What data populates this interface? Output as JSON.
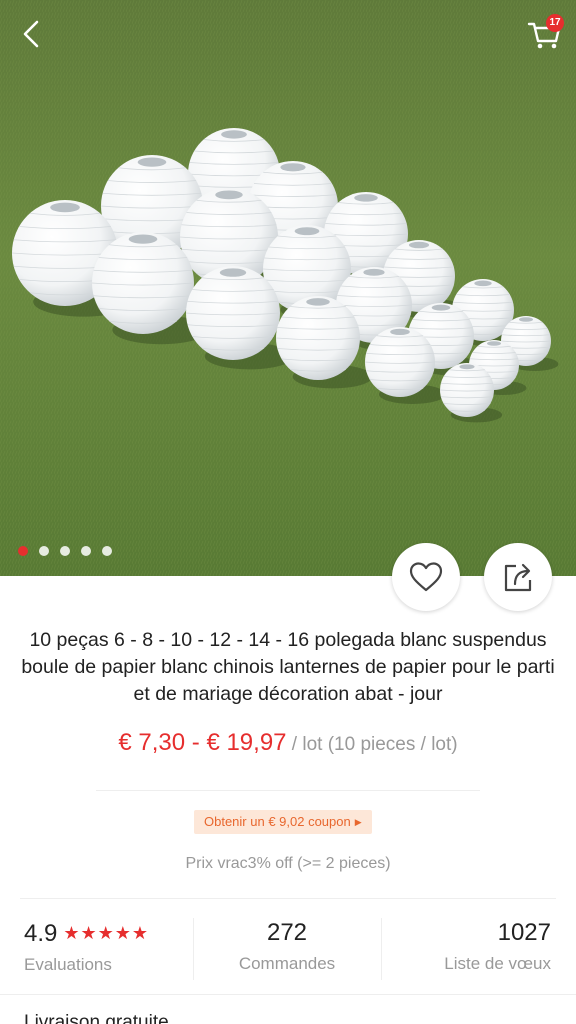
{
  "header": {
    "cart_count": "17"
  },
  "gallery": {
    "image_alt": "White paper lanterns on grass",
    "dots": 5,
    "active_dot": 0
  },
  "product": {
    "title": "10 peças 6 - 8 - 10 - 12 - 14 - 16 polegada blanc suspendus boule de papier blanc chinois lanternes de papier pour le parti et de mariage décoration abat - jour",
    "price_range": "€ 7,30 - € 19,97",
    "unit": " / lot (10 pieces / lot)",
    "coupon": "Obtenir un € 9,02 coupon",
    "bulk_price": "Prix vrac3% off (>= 2 pieces)"
  },
  "stats": {
    "rating": "4.9",
    "stars": "★★★★★",
    "rating_label": "Evaluations",
    "orders": "272",
    "orders_label": "Commandes",
    "wishlist": "1027",
    "wishlist_label": "Liste de vœux"
  },
  "shipping": {
    "label": "Livraison gratuite"
  },
  "colors": {
    "accent": "#e62e2e",
    "coupon_bg": "#fde7d8",
    "coupon_text": "#e8672e",
    "muted": "#999999"
  }
}
